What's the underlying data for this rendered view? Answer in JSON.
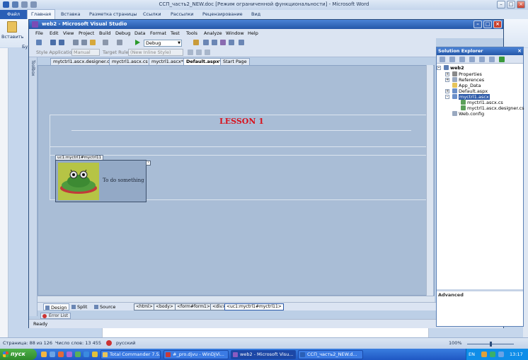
{
  "word": {
    "title": "ССП_часть2_NEW.doc [Режим ограниченной функциональности] - Microsoft Word",
    "file_tab": "Файл",
    "tabs": [
      "Главная",
      "Вставка",
      "Разметка страницы",
      "Ссылки",
      "Рассылки",
      "Рецензирование",
      "Вид"
    ],
    "paste_label": "Вставить",
    "clipboard_label": "Бу",
    "status": {
      "page": "Страница: 88 из 126",
      "words": "Число слов: 13 455",
      "language": "русский",
      "zoom": "100%"
    }
  },
  "vs": {
    "title": "web2 - Microsoft Visual Studio",
    "menu": [
      "File",
      "Edit",
      "View",
      "Project",
      "Build",
      "Debug",
      "Data",
      "Format",
      "Test",
      "Tools",
      "Analyze",
      "Window",
      "Help"
    ],
    "config": "Debug",
    "toolbar2": {
      "style_app_label": "Style Application:",
      "style_app_value": "Manual",
      "target_rule_label": "Target Rule:",
      "target_rule_value": "(New Inline Style)"
    },
    "toolbox_label": "Toolbox",
    "doc_tabs": [
      "mytctrl1.ascx.designer.cs",
      "myctrl1.ascx.cs",
      "myctrl1.ascx*",
      "Default.aspx*",
      "Start Page"
    ],
    "active_tab_index": 3,
    "design": {
      "lesson_title": "LESSON 1",
      "uc_tag": "uc1:myctrl1#myctrl11",
      "uc_text": "To do something"
    },
    "views": [
      "Design",
      "Split",
      "Source"
    ],
    "breadcrumbs": [
      "<html>",
      "<body>",
      "<form#form1>",
      "<div>",
      "<uc1:myctrl1#myctrl11>"
    ],
    "error_list": "Error List",
    "status": "Ready"
  },
  "solution_explorer": {
    "title": "Solution Explorer",
    "close": "×",
    "items": [
      {
        "label": "web2",
        "bold": true
      },
      {
        "label": "Properties"
      },
      {
        "label": "References"
      },
      {
        "label": "App_Data"
      },
      {
        "label": "Default.aspx"
      },
      {
        "label": "myctrl1.ascx",
        "selected": true
      },
      {
        "label": "myctrl1.ascx.cs"
      },
      {
        "label": "myctrl1.ascx.designer.cs"
      },
      {
        "label": "Web.config"
      }
    ],
    "properties_header": "Advanced"
  },
  "taskbar": {
    "start": "пуск",
    "tasks": [
      {
        "label": "Total Commander 7.5...",
        "active": false
      },
      {
        "label": "#_pro.djvu - WinDjVi...",
        "active": false
      },
      {
        "label": "web2 - Microsoft Visu...",
        "active": true
      },
      {
        "label": "ССП_часть2_NEW.d...",
        "active": false
      }
    ],
    "language": "EN",
    "clock": "13:17"
  },
  "colors": {
    "lesson_title": "#d8121d",
    "vs_title_bar": "#2457a8",
    "taskbar": "#1f57c3",
    "selection": "#2d5aa8"
  }
}
